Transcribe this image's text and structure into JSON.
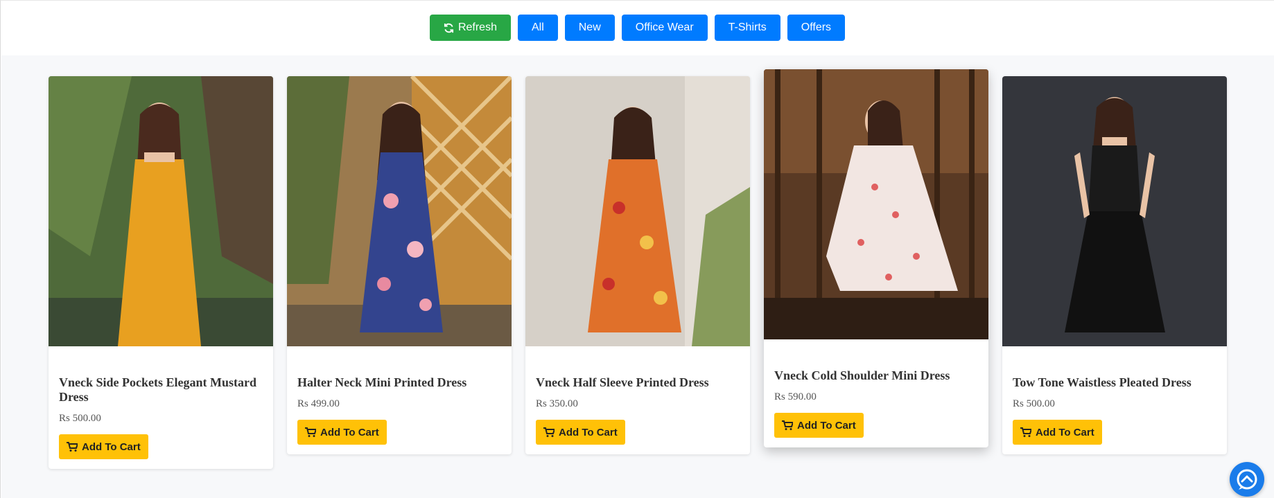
{
  "filters": {
    "refresh_label": "Refresh",
    "buttons": [
      "All",
      "New",
      "Office Wear",
      "T-Shirts",
      "Offers"
    ]
  },
  "products": [
    {
      "title": "Vneck Side Pockets Elegant Mustard Dress",
      "price": "Rs 500.00",
      "cart_label": "Add To Cart",
      "dress_color": "#e8a020",
      "bg_color": "#4f6a3a"
    },
    {
      "title": "Halter Neck Mini Printed Dress",
      "price": "Rs 499.00",
      "cart_label": "Add To Cart",
      "dress_color": "#33448e",
      "bg_color": "#9b7a4e"
    },
    {
      "title": "Vneck Half Sleeve Printed Dress",
      "price": "Rs 350.00",
      "cart_label": "Add To Cart",
      "dress_color": "#e0702a",
      "bg_color": "#d6d0c8"
    },
    {
      "title": "Vneck Cold Shoulder Mini Dress",
      "price": "Rs 590.00",
      "cart_label": "Add To Cart",
      "dress_color": "#f2e6e2",
      "bg_color": "#5a3a24"
    },
    {
      "title": "Tow Tone Waistless Pleated Dress",
      "price": "Rs 500.00",
      "cart_label": "Add To Cart",
      "dress_color": "#111111",
      "bg_color": "#34363c"
    }
  ],
  "colors": {
    "accent_blue": "#007bff",
    "refresh_green": "#28a745",
    "cart_yellow": "#ffc107",
    "chat_blue": "#1a7cea"
  },
  "icons": {
    "refresh": "refresh-icon",
    "cart": "cart-icon",
    "chat": "chat-icon"
  }
}
